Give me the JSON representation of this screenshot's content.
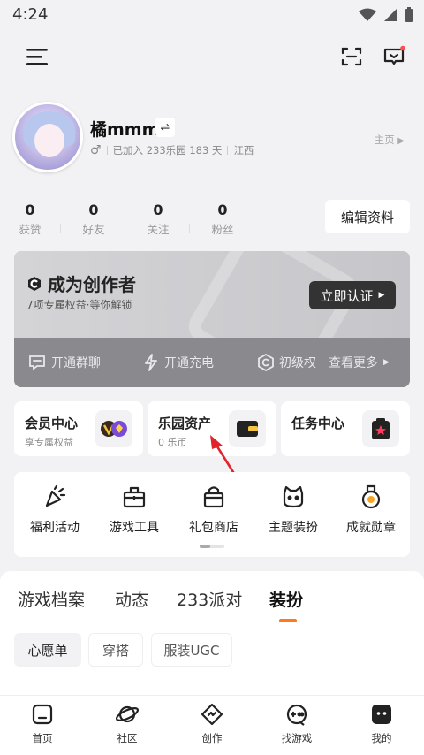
{
  "status_bar": {
    "time": "4:24"
  },
  "profile": {
    "username": "橘mmm",
    "gender_symbol": "♂",
    "joined_text": "已加入 233乐园 183 天",
    "location": "江西",
    "home_link": "主页"
  },
  "stats": [
    {
      "value": "0",
      "label": "获赞"
    },
    {
      "value": "0",
      "label": "好友"
    },
    {
      "value": "0",
      "label": "关注"
    },
    {
      "value": "0",
      "label": "粉丝"
    }
  ],
  "edit_button": "编辑资料",
  "creator_banner": {
    "title": "成为创作者",
    "subtitle": "7项专属权益·等你解锁",
    "verify_button": "立即认证",
    "perks": [
      "开通群聊",
      "开通充电",
      "初级权"
    ],
    "more": "查看更多"
  },
  "quick_cards": [
    {
      "title": "会员中心",
      "subtitle": "享专属权益",
      "icon": "vip-badge-icon"
    },
    {
      "title": "乐园资产",
      "subtitle": "0 乐币",
      "icon": "wallet-icon"
    },
    {
      "title": "任务中心",
      "subtitle": "",
      "icon": "task-star-icon"
    }
  ],
  "tools": [
    {
      "label": "福利活动",
      "icon": "party-popper-icon"
    },
    {
      "label": "游戏工具",
      "icon": "toolbox-icon"
    },
    {
      "label": "礼包商店",
      "icon": "gift-bag-icon"
    },
    {
      "label": "主题装扮",
      "icon": "cat-face-icon"
    },
    {
      "label": "成就勋章",
      "icon": "medal-icon"
    }
  ],
  "tools_page": {
    "current": 1,
    "total": 2
  },
  "content_tabs": [
    {
      "label": "游戏档案",
      "active": false
    },
    {
      "label": "动态",
      "active": false
    },
    {
      "label": "233派对",
      "active": false
    },
    {
      "label": "装扮",
      "active": true
    }
  ],
  "chips": [
    {
      "label": "心愿单",
      "active": true
    },
    {
      "label": "穿搭",
      "active": false
    },
    {
      "label": "服装UGC",
      "active": false
    }
  ],
  "bottom_nav": [
    {
      "label": "首页",
      "icon": "home-icon"
    },
    {
      "label": "社区",
      "icon": "planet-icon"
    },
    {
      "label": "创作",
      "icon": "create-icon"
    },
    {
      "label": "找游戏",
      "icon": "gamepad-icon"
    },
    {
      "label": "我的",
      "icon": "profile-face-icon"
    }
  ],
  "colors": {
    "accent": "#ff7a1a",
    "annotation_arrow": "#e0242a"
  }
}
